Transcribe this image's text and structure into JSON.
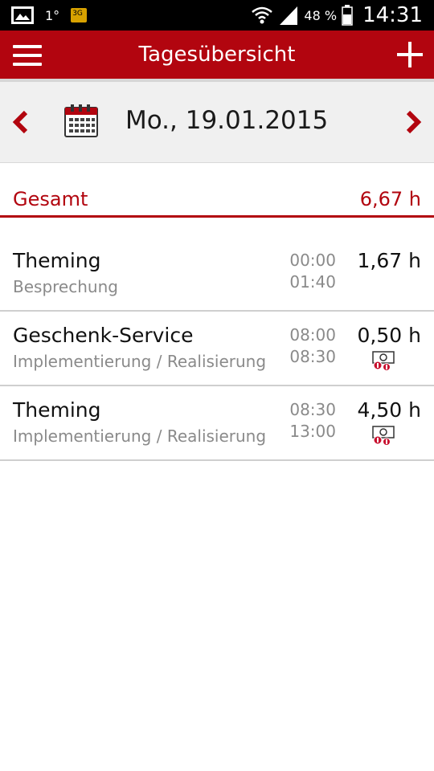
{
  "status_bar": {
    "notification_count": "1°",
    "network_type": "3G",
    "battery_percent": "48 %",
    "time": "14:31",
    "icons": [
      "image-notification-icon",
      "sim-3g-icon",
      "wifi-icon",
      "signal-icon",
      "battery-icon"
    ]
  },
  "app_bar": {
    "title": "Tagesübersicht",
    "background_color": "#b2050f",
    "icons": [
      "hamburger-menu-icon",
      "plus-icon"
    ]
  },
  "date_nav": {
    "date": "Mo., 19.01.2015",
    "icons": [
      "chevron-left-icon",
      "calendar-icon",
      "chevron-right-icon"
    ]
  },
  "total": {
    "label": "Gesamt",
    "value": "6,67 h"
  },
  "entries": [
    {
      "title": "Theming",
      "subtitle": "Besprechung",
      "start": "00:00",
      "end": "01:40",
      "hours": "1,67 h",
      "billing_icon": false
    },
    {
      "title": "Geschenk-Service",
      "subtitle": "Implementierung / Realisierung",
      "start": "08:00",
      "end": "08:30",
      "hours": "0,50 h",
      "billing_icon": true
    },
    {
      "title": "Theming",
      "subtitle": "Implementierung / Realisierung",
      "start": "08:30",
      "end": "13:00",
      "hours": "4,50 h",
      "billing_icon": true
    }
  ],
  "colors": {
    "accent": "#b2050f",
    "date_bar_bg": "#f0f0f0",
    "secondary_text": "#8a8a8a"
  }
}
